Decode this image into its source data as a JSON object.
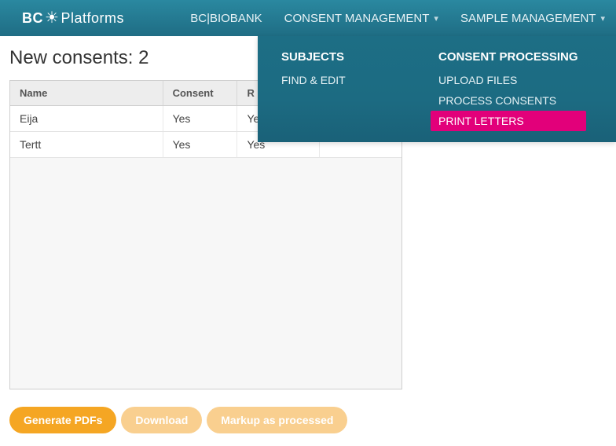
{
  "logo": {
    "part1": "BC",
    "part2": "Platforms"
  },
  "nav": {
    "items": [
      {
        "label": "BC|BIOBANK",
        "dropdown": false
      },
      {
        "label": "CONSENT MANAGEMENT",
        "dropdown": true
      },
      {
        "label": "SAMPLE MANAGEMENT",
        "dropdown": true
      }
    ]
  },
  "mega": {
    "col1": {
      "head": "SUBJECTS",
      "items": [
        "FIND & EDIT"
      ]
    },
    "col2": {
      "head": "CONSENT PROCESSING",
      "items": [
        "UPLOAD FILES",
        "PROCESS CONSENTS",
        "PRINT LETTERS"
      ],
      "activeIndex": 2
    }
  },
  "page": {
    "title": "New consents: 2"
  },
  "table": {
    "headers": [
      "Name",
      "Consent",
      "R",
      ""
    ],
    "rows": [
      {
        "name": "Eija",
        "consent": "Yes",
        "r": "Yes",
        "x": ""
      },
      {
        "name": "Tertt",
        "consent": "Yes",
        "r": "Yes",
        "x": ""
      }
    ]
  },
  "buttons": {
    "generate": "Generate PDFs",
    "download": "Download",
    "markup": "Markup as processed"
  }
}
